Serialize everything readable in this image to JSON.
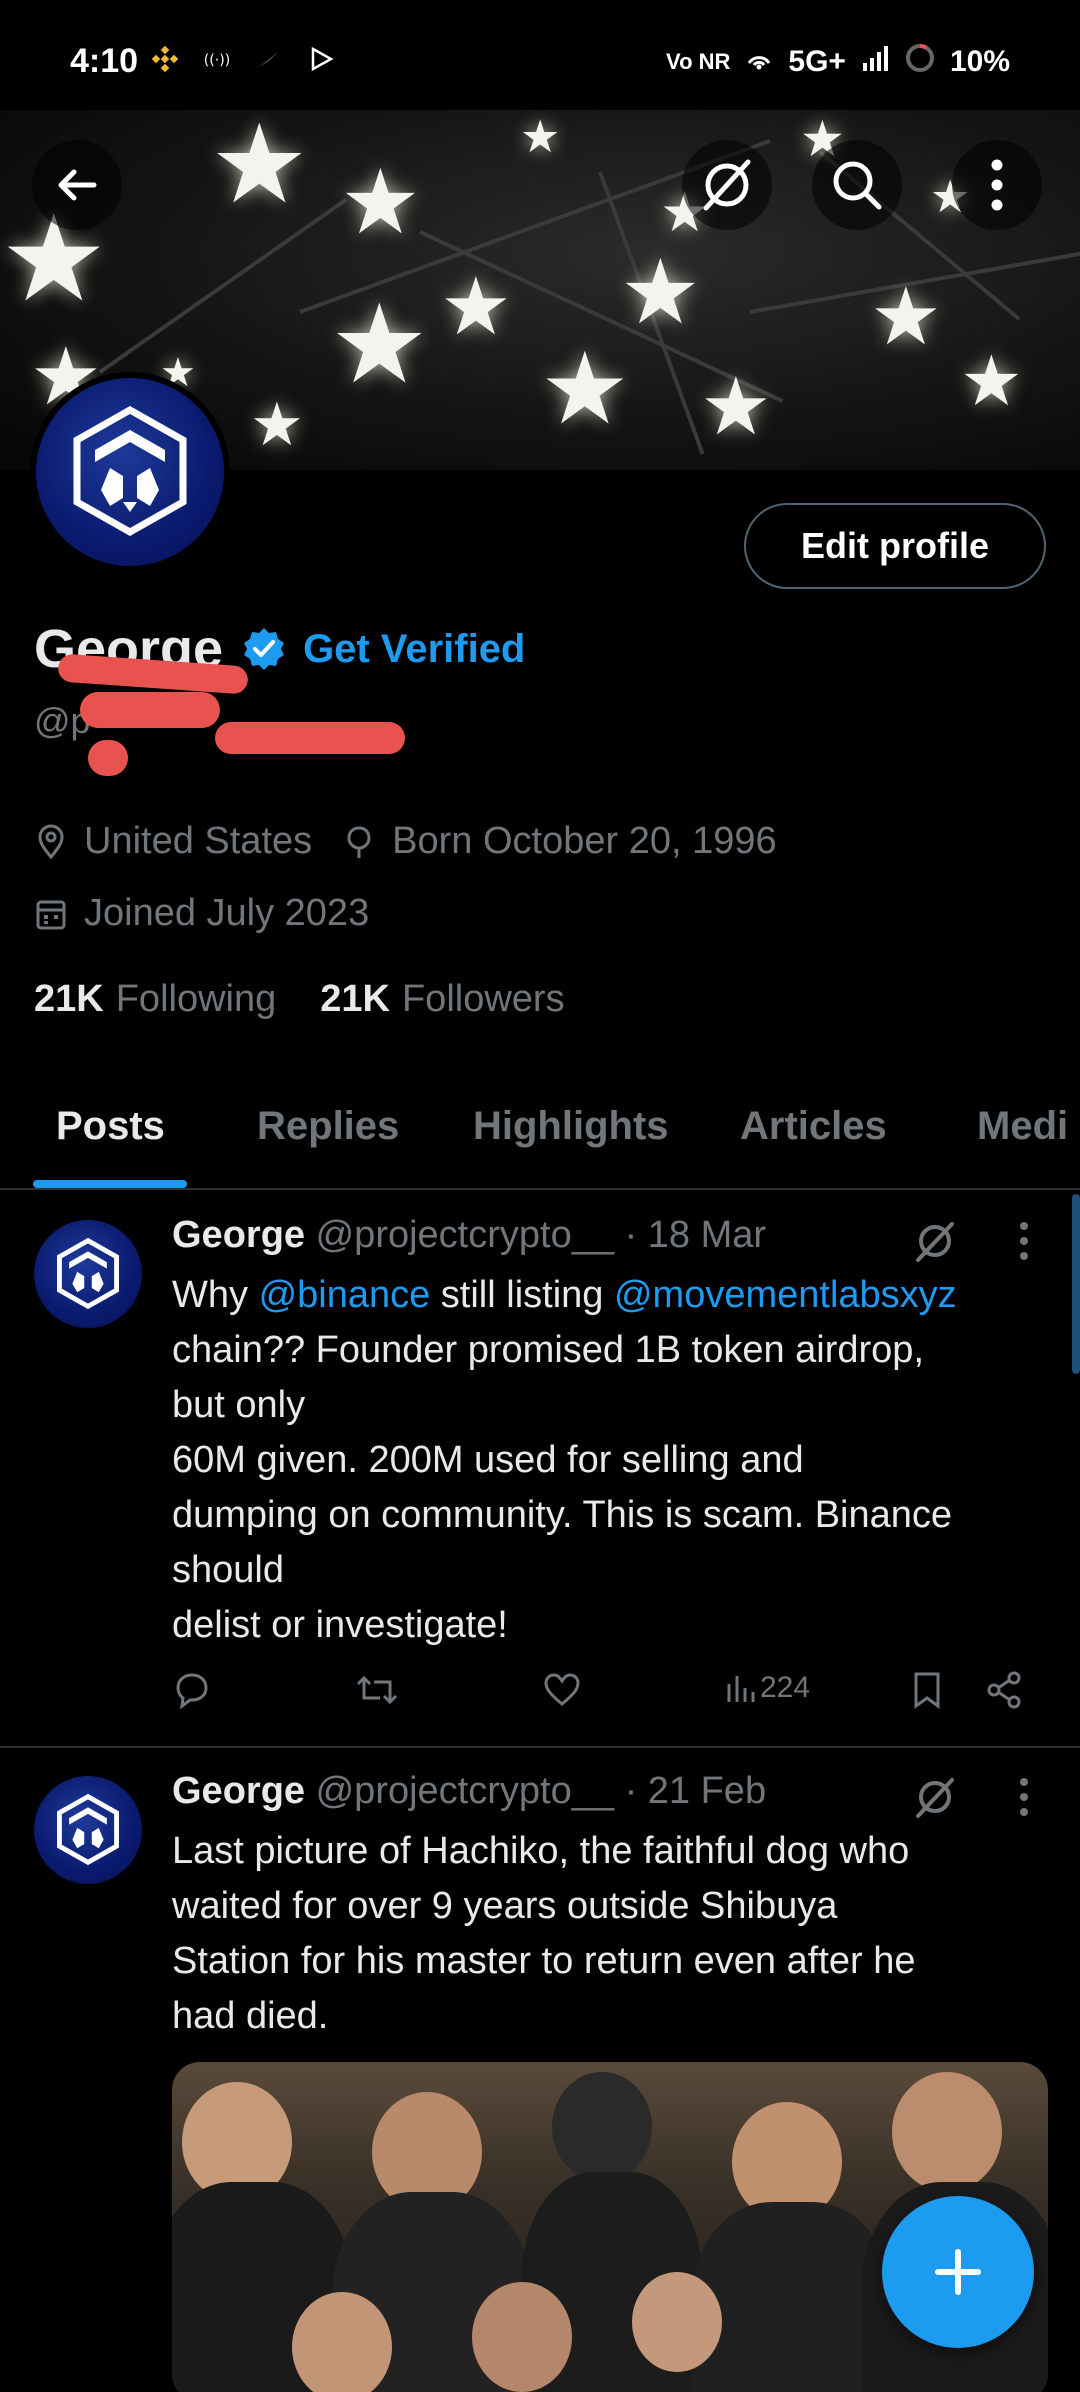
{
  "status_bar": {
    "time": "4:10",
    "network": "5G+",
    "battery": "10%",
    "volte_label": "Vo NR"
  },
  "profile": {
    "name": "George",
    "get_verified": "Get Verified",
    "handle_visible": "@p",
    "edit_button": "Edit profile",
    "location": "United States",
    "born": "Born October 20, 1996",
    "joined": "Joined July 2023",
    "following_count": "21K",
    "following_label": "Following",
    "followers_count": "21K",
    "followers_label": "Followers"
  },
  "tabs": [
    {
      "label": "Posts",
      "active": true
    },
    {
      "label": "Replies",
      "active": false
    },
    {
      "label": "Highlights",
      "active": false
    },
    {
      "label": "Articles",
      "active": false
    },
    {
      "label": "Medi",
      "active": false
    }
  ],
  "tweets": [
    {
      "author": "George",
      "handle": "@projectcrypto__",
      "date": "· 18 Mar",
      "text_parts": {
        "p1": "Why ",
        "mention1": "@binance",
        "p2": " still listing ",
        "mention2": "@movementlabsxyz",
        "line2": "chain?? Founder promised 1B token airdrop,",
        "line3": "but only",
        "line4": "60M given. 200M used for selling and",
        "line5": "dumping on community. This is scam. Binance",
        "line6": "should",
        "line7": "delist or investigate!"
      },
      "views": "224"
    },
    {
      "author": "George",
      "handle": "@projectcrypto__",
      "date": "· 21 Feb",
      "lines": [
        "Last picture of Hachiko, the faithful dog who",
        "waited for over 9 years outside Shibuya",
        "Station for his master to return even after he",
        "had died."
      ]
    }
  ],
  "colors": {
    "accent": "#1d9bf0",
    "muted": "#71767b",
    "text": "#e7e9ea",
    "redaction": "#e8534f"
  },
  "icons": [
    "back-arrow-icon",
    "grok-icon",
    "search-icon",
    "more-icon",
    "location-pin-icon",
    "birthday-icon",
    "calendar-icon",
    "verified-badge-icon",
    "reply-icon",
    "retweet-icon",
    "like-icon",
    "views-icon",
    "bookmark-icon",
    "share-icon",
    "plus-icon"
  ]
}
